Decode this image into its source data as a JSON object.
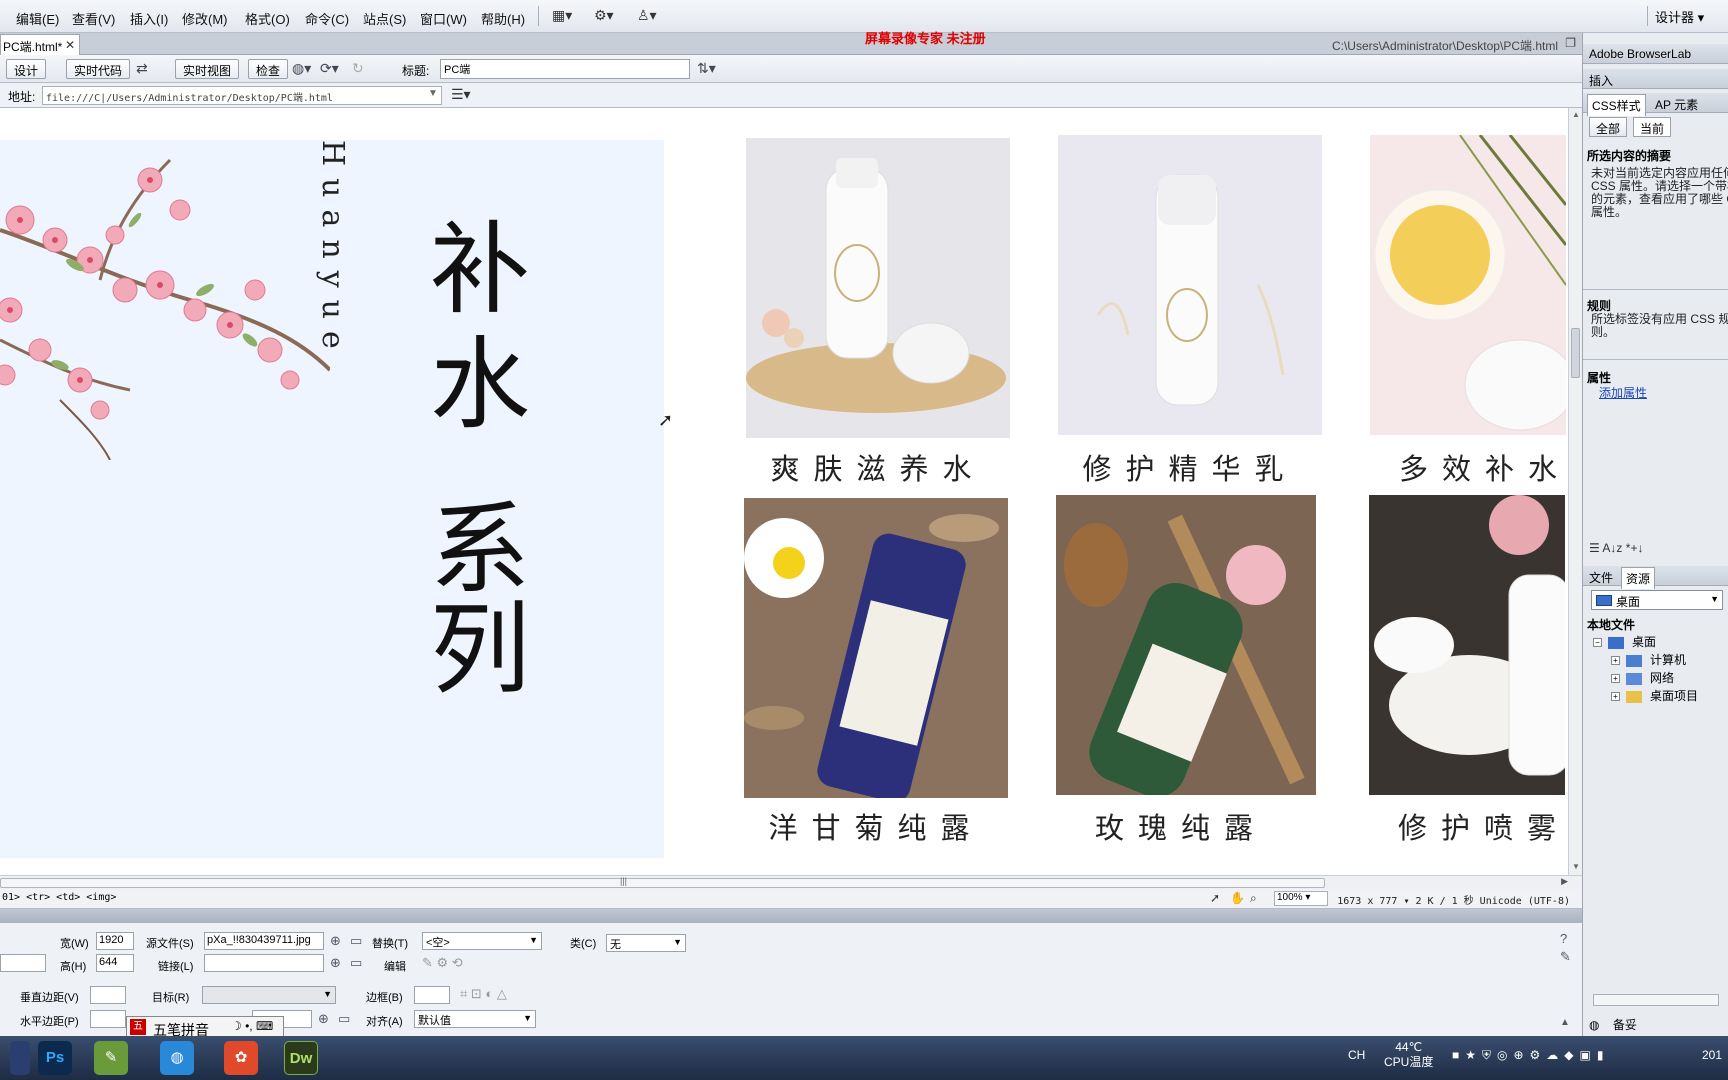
{
  "menubar": {
    "items": [
      "编辑(E)",
      "查看(V)",
      "插入(I)",
      "修改(M)",
      "格式(O)",
      "命令(C)",
      "站点(S)",
      "窗口(W)",
      "帮助(H)"
    ],
    "workspace": "设计器"
  },
  "watermark": "屏幕录像专家  未注册",
  "document": {
    "tab_label": "PC端.html*",
    "path": "C:\\Users\\Administrator\\Desktop\\PC端.html",
    "toolbar": {
      "design": "设计",
      "live_code": "实时代码",
      "live_view": "实时视图",
      "inspect": "检查",
      "title_label": "标题:",
      "title_value": "PC端"
    },
    "address_label": "地址:",
    "address_value": "file:///C|/Users/Administrator/Desktop/PC端.html"
  },
  "page": {
    "brand_vertical": "Huanyue",
    "series_chars": [
      "补",
      "水",
      "系",
      "列"
    ],
    "products": [
      {
        "caption": "爽肤滋养水"
      },
      {
        "caption": "修护精华乳"
      },
      {
        "caption": "多效补水"
      },
      {
        "caption": "洋甘菊纯露"
      },
      {
        "caption": "玫瑰纯露"
      },
      {
        "caption": "修护喷雾"
      }
    ]
  },
  "status": {
    "tag_selector": "01> <tr> <td> <img>",
    "zoom": "100%",
    "info": "1673 x 777 ▾  2 K / 1 秒  Unicode (UTF-8)"
  },
  "properties": {
    "width_label": "宽(W)",
    "width_value": "1920",
    "height_label": "高(H)",
    "height_value": "644",
    "src_label": "源文件(S)",
    "src_value": "pXa_!!830439711.jpg",
    "alt_label": "替换(T)",
    "alt_value": "<空>",
    "class_label": "类(C)",
    "class_value": "无",
    "link_label": "链接(L)",
    "edit_label": "编辑",
    "vspace_label": "垂直边距(V)",
    "target_label": "目标(R)",
    "border_label": "边框(B)",
    "hspace_label": "水平边距(P)",
    "align_label": "对齐(A)",
    "align_value": "默认值",
    "ime_name": "五笔拼音"
  },
  "right_panel": {
    "browserlab": "Adobe BrowserLab",
    "insert_tab": "插入",
    "css_tab": "CSS样式",
    "ap_tab": "AP 元素",
    "all_btn": "全部",
    "current_btn": "当前",
    "summary_title": "所选内容的摘要",
    "summary_text": "未对当前选定内容应用任何 CSS 属性。请选择一个带样式的元素，查看应用了哪些 CSS 属性。",
    "rules_title": "规则",
    "rules_text": "所选标签没有应用 CSS 规则。",
    "props_title": "属性",
    "add_prop": "添加属性",
    "files_tab": "文件",
    "assets_tab": "资源",
    "location": "桌面",
    "local_files": "本地文件",
    "tree": [
      "桌面",
      "计算机",
      "网络",
      "桌面项目"
    ],
    "log_label": "备妥"
  },
  "taskbar": {
    "apps": [
      "Ps",
      "Dw"
    ],
    "lang": "CH",
    "cpu_temp": "44℃",
    "cpu_label": "CPU温度",
    "clock": "201"
  },
  "colors": {
    "hero_bg": "#eef5ff",
    "watermark": "#e00000",
    "link": "#1d46b5"
  }
}
